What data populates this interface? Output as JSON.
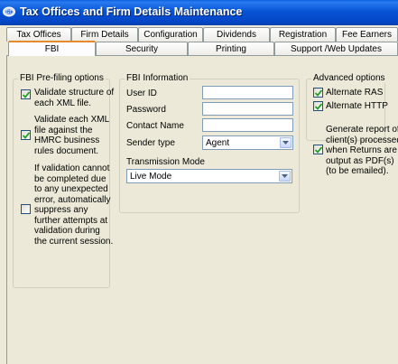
{
  "window": {
    "title": "Tax Offices and Firm Details Maintenance",
    "icon": "app-icon"
  },
  "tabs_row1": [
    "Tax Offices",
    "Firm Details",
    "Configuration",
    "Dividends",
    "Registration",
    "Fee Earners"
  ],
  "tabs_row2": [
    "FBI",
    "Security",
    "Printing",
    "Support /Web Updates"
  ],
  "active_tab": "FBI",
  "prefiling": {
    "title": "FBI Pre-filing options",
    "validate_structure": [
      "Validate structure of",
      "each XML file."
    ],
    "validate_rules": [
      "Validate each XML",
      "file against the",
      "HMRC business",
      "rules document."
    ],
    "suppress": [
      "If validation cannot",
      "be completed due",
      "to any unexpected",
      "error, automatically",
      "suppress any",
      "further attempts at",
      "validation during",
      "the current session."
    ]
  },
  "fbi_info": {
    "title": "FBI Information",
    "user_id_label": "User ID",
    "user_id_value": "",
    "password_label": "Password",
    "password_value": "",
    "contact_label": "Contact Name",
    "contact_value": "",
    "sender_type_label": "Sender type",
    "sender_type_value": "Agent",
    "transmission_label": "Transmission Mode",
    "transmission_value": "Live Mode"
  },
  "advanced": {
    "title": "Advanced options",
    "alternate_ras": "Alternate RAS",
    "alternate_http": "Alternate HTTP"
  },
  "pdf_report": [
    "Generate report of",
    "client(s) processed",
    "when Returns are",
    "output as PDF(s)",
    "(to be emailed)."
  ],
  "checkboxes": {
    "validate_structure": true,
    "validate_rules": true,
    "suppress": false,
    "alternate_ras": true,
    "alternate_http": true,
    "pdf_report": true
  }
}
